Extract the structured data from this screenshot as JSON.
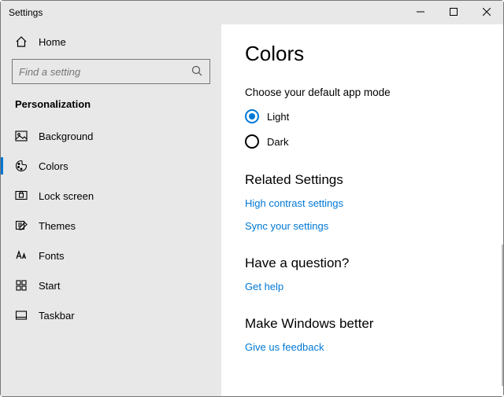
{
  "window": {
    "title": "Settings"
  },
  "sidebar": {
    "home_label": "Home",
    "search_placeholder": "Find a setting",
    "category": "Personalization",
    "items": [
      {
        "label": "Background"
      },
      {
        "label": "Colors"
      },
      {
        "label": "Lock screen"
      },
      {
        "label": "Themes"
      },
      {
        "label": "Fonts"
      },
      {
        "label": "Start"
      },
      {
        "label": "Taskbar"
      }
    ]
  },
  "page": {
    "title": "Colors",
    "mode_prompt": "Choose your default app mode",
    "mode_light": "Light",
    "mode_dark": "Dark",
    "related_head": "Related Settings",
    "link_high_contrast": "High contrast settings",
    "link_sync": "Sync your settings",
    "question_head": "Have a question?",
    "link_help": "Get help",
    "better_head": "Make Windows better",
    "link_feedback": "Give us feedback"
  }
}
